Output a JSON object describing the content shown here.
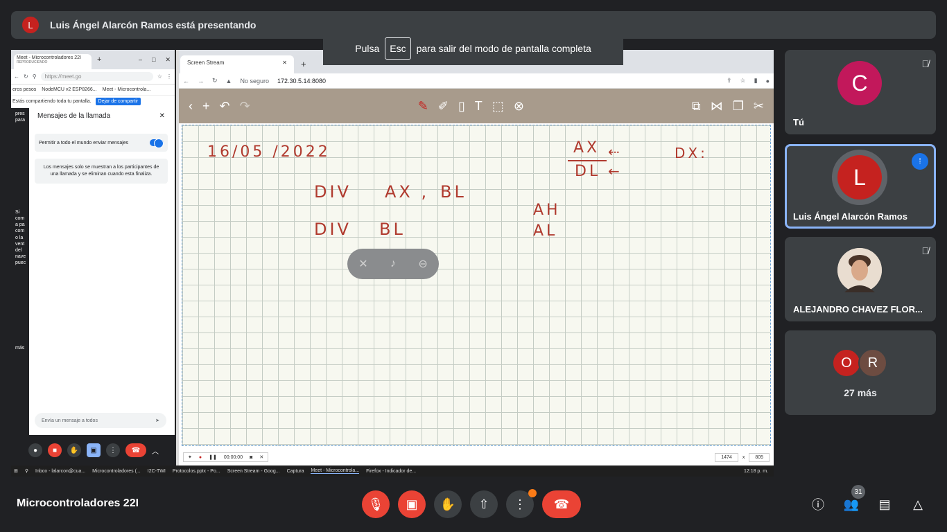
{
  "banner": {
    "avatar_letter": "L",
    "text": "Luis Ángel Alarcón Ramos está presentando"
  },
  "toast": {
    "before": "Pulsa",
    "key": "Esc",
    "after": "para salir del modo de pantalla completa"
  },
  "left_window": {
    "tab_title": "Meet - Microcontroladores 22I",
    "tab_subtitle": "REPRODUCIENDO",
    "url": "https://meet.go",
    "bookmarks": [
      "eros pesos",
      "NodeMCU v2 ESP8266...",
      "Meet - Microcontrola..."
    ],
    "share_text": "Estás compartiendo toda tu pantalla.",
    "share_button": "Dejar de compartir",
    "side_text": "Si com a pa com o la vent del nave puec",
    "side_top": "pres para",
    "panel_title": "Mensajes de la llamada",
    "toggle_label": "Permitir a todo el mundo enviar mensajes",
    "note": "Los mensajes solo se muestran a los participantes de una llamada y se eliminan cuando esta finaliza.",
    "input_placeholder": "Envía un mensaje a todos",
    "side_more": "más"
  },
  "main_window": {
    "tab_title": "Screen Stream",
    "security": "No seguro",
    "url": "172.30.5.14:8080",
    "status_time": "00:00:00",
    "zoom_w": "1474",
    "zoom_x": "x",
    "zoom_h": "805"
  },
  "whiteboard": {
    "date": "16/05 /2022",
    "line1a": "DIV",
    "line1b": "AX ,",
    "line1c": "BL",
    "line2a": "DIV",
    "line2b": "BL",
    "ax": "AX",
    "dl": "DL",
    "ah": "AH",
    "al": "AL",
    "dx": "DX:"
  },
  "taskbar": {
    "items": [
      "Inbox - lalarcon@cua...",
      "Microcontroladores (...",
      "I2C-TWI",
      "Protocolos.pptx - Po...",
      "Screen Stream - Goog...",
      "Captura",
      "Meet - Microcontrola...",
      "Firefox - Indicador de..."
    ],
    "clock": "12:18 p. m."
  },
  "participants": [
    {
      "letter": "C",
      "name": "Tú",
      "color": "#c2185b",
      "muted": true
    },
    {
      "letter": "L",
      "name": "Luis Ángel Alarcón Ramos",
      "color": "#c5221f",
      "speaking": true
    },
    {
      "letter": "",
      "name": "ALEJANDRO CHAVEZ FLOR...",
      "muted": true
    },
    {
      "avatars": [
        "O",
        "R"
      ],
      "label": "27 más"
    }
  ],
  "bottom": {
    "meeting_name": "Microcontroladores 22I",
    "people_count": "31"
  },
  "colors": {
    "accent": "#1a73e8",
    "danger": "#ea4335",
    "ink": "#b03a2e"
  }
}
